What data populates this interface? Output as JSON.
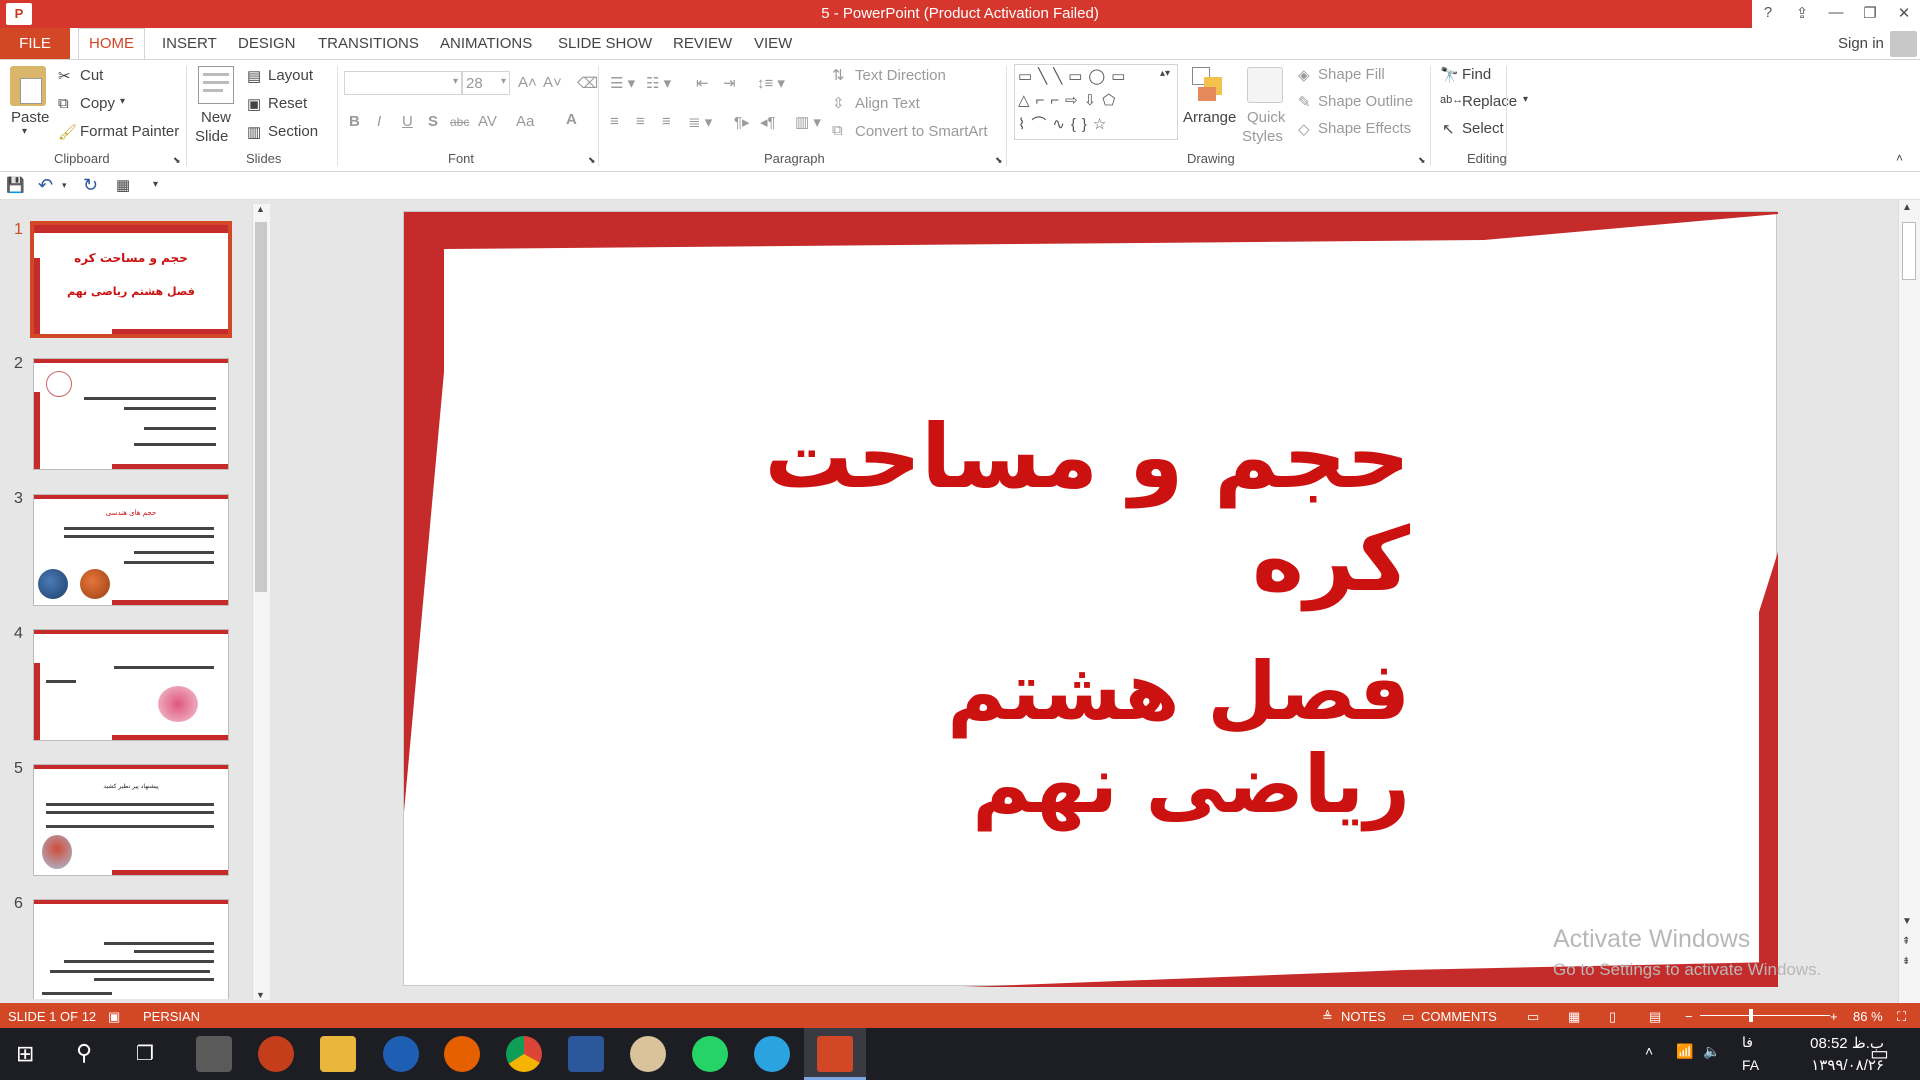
{
  "window": {
    "title": "5 -  PowerPoint (Product Activation Failed)",
    "help": "?",
    "minimize": "—",
    "restore": "❐",
    "close": "✕"
  },
  "tabs": {
    "file": "FILE",
    "home": "HOME",
    "insert": "INSERT",
    "design": "DESIGN",
    "transitions": "TRANSITIONS",
    "animations": "ANIMATIONS",
    "slideshow": "SLIDE SHOW",
    "review": "REVIEW",
    "view": "VIEW",
    "signin": "Sign in"
  },
  "ribbon": {
    "clipboard": {
      "group_label": "Clipboard",
      "paste": "Paste",
      "cut": "Cut",
      "copy": "Copy",
      "format_painter": "Format Painter"
    },
    "slides": {
      "group_label": "Slides",
      "new_slide_1": "New",
      "new_slide_2": "Slide",
      "layout": "Layout",
      "reset": "Reset",
      "section": "Section"
    },
    "font": {
      "group_label": "Font",
      "font_name": "",
      "font_size": "28",
      "bold": "B",
      "italic": "I",
      "underline": "U",
      "shadow": "S",
      "strike": "abc",
      "spacing": "AV",
      "case": "Aa",
      "color": "A"
    },
    "paragraph": {
      "group_label": "Paragraph",
      "text_direction": "Text Direction",
      "align_text": "Align Text",
      "convert_smartart": "Convert to SmartArt"
    },
    "drawing": {
      "group_label": "Drawing",
      "arrange": "Arrange",
      "quick_styles_1": "Quick",
      "quick_styles_2": "Styles",
      "shape_fill": "Shape Fill",
      "shape_outline": "Shape Outline",
      "shape_effects": "Shape Effects"
    },
    "editing": {
      "group_label": "Editing",
      "find": "Find",
      "replace": "Replace",
      "select": "Select"
    }
  },
  "thumbnails": {
    "numbers": [
      "1",
      "2",
      "3",
      "4",
      "5",
      "6"
    ],
    "slide1_title": "حجم و مساحت کره",
    "slide1_sub": "فصل هشتم ریاضی نهم",
    "slide3_heading": "حجم های هندسی",
    "slide5_heading": "پیشنهاد پیر نظیر کشید"
  },
  "slide": {
    "title": "حجم و مساحت کره",
    "subtitle": "فصل هشتم ریاضی نهم"
  },
  "watermark": {
    "line1": "Activate Windows",
    "line2": "Go to Settings to activate Windows."
  },
  "statusbar": {
    "slide_counter": "SLIDE 1 OF 12",
    "language": "PERSIAN",
    "notes": "NOTES",
    "comments": "COMMENTS",
    "zoom": "86 %"
  },
  "taskbar": {
    "time": "08:52 ب.ظ",
    "date": "۱۳۹۹/۰۸/۲۶",
    "lang_top": "فا",
    "lang": "FA"
  },
  "colors": {
    "accent": "#d24726",
    "slide_red": "#cc1111",
    "frame_red": "#c62b2b"
  }
}
